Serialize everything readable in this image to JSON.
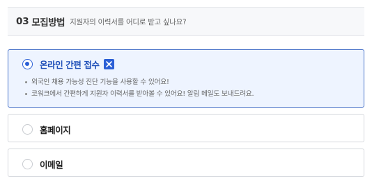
{
  "section": {
    "number": "03",
    "title": "모집방법",
    "description": "지원자의 이력서를 어디로 받고 싶나요?"
  },
  "options": [
    {
      "label": "온라인 간편 접수",
      "selected": true,
      "badge_icon": "kowork-logo-icon",
      "bullets": [
        "외국인 채용 가능성 진단 기능을 사용할 수 있어요!",
        "코워크에서 간편하게 지원자 이력서를 받아볼 수 있어요! 알림 메일도 보내드려요."
      ]
    },
    {
      "label": "홈페이지",
      "selected": false
    },
    {
      "label": "이메일",
      "selected": false
    }
  ],
  "colors": {
    "accent": "#2b5fd6",
    "selected_bg": "#eef4ff",
    "selected_border": "#4a73c9"
  }
}
